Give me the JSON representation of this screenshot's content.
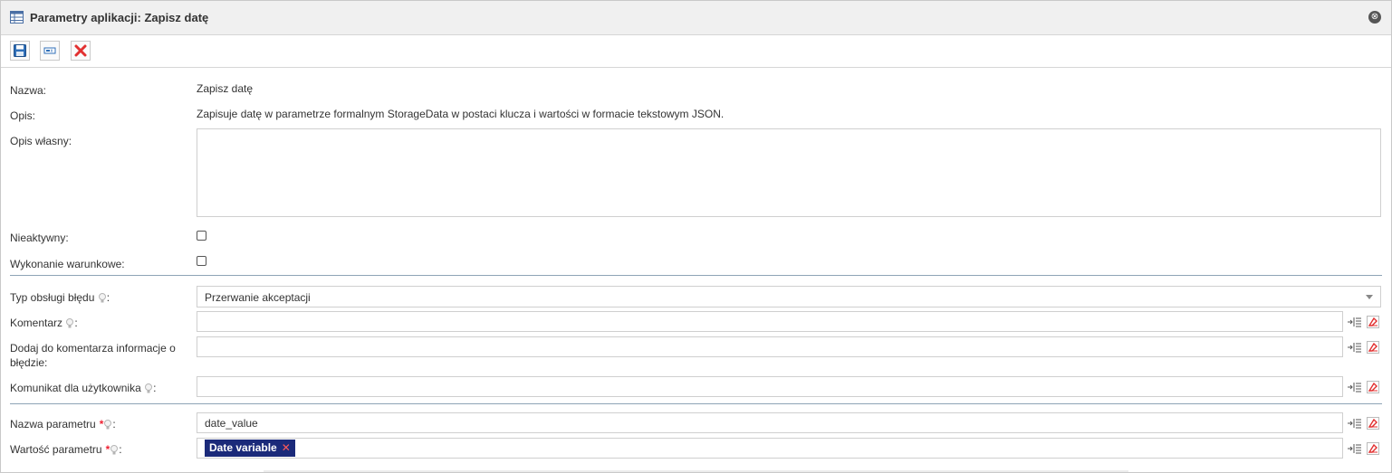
{
  "window": {
    "title": "Parametry aplikacji: Zapisz datę",
    "close_label": "⊗"
  },
  "toolbar": {
    "buttons": [
      {
        "name": "save-icon"
      },
      {
        "name": "edit-field-icon"
      },
      {
        "name": "delete-icon"
      }
    ]
  },
  "form": {
    "name_label": "Nazwa:",
    "name_value": "Zapisz datę",
    "description_label": "Opis:",
    "description_value": "Zapisuje datę w parametrze formalnym StorageData w postaci klucza i wartości w formacie tekstowym JSON.",
    "own_description_label": "Opis własny:",
    "inactive_label": "Nieaktywny:",
    "conditional_label": "Wykonanie warunkowe:",
    "error_type_label": "Typ obsługi błędu",
    "error_type_value": "Przerwanie akceptacji",
    "comment_label": "Komentarz",
    "add_error_info_label_1": "Dodaj do komentarza informacje o",
    "add_error_info_label_2": "błędzie:",
    "user_message_label": "Komunikat dla użytkownika",
    "param_name_label": "Nazwa parametru",
    "param_name_value": "date_value",
    "param_value_label": "Wartość parametru",
    "param_value_tag": "Date variable",
    "required_marker": "*",
    "colon": ":"
  },
  "colors": {
    "accent": "#1b2a7a",
    "separator": "#8ea4b6",
    "delete": "#e23030"
  }
}
